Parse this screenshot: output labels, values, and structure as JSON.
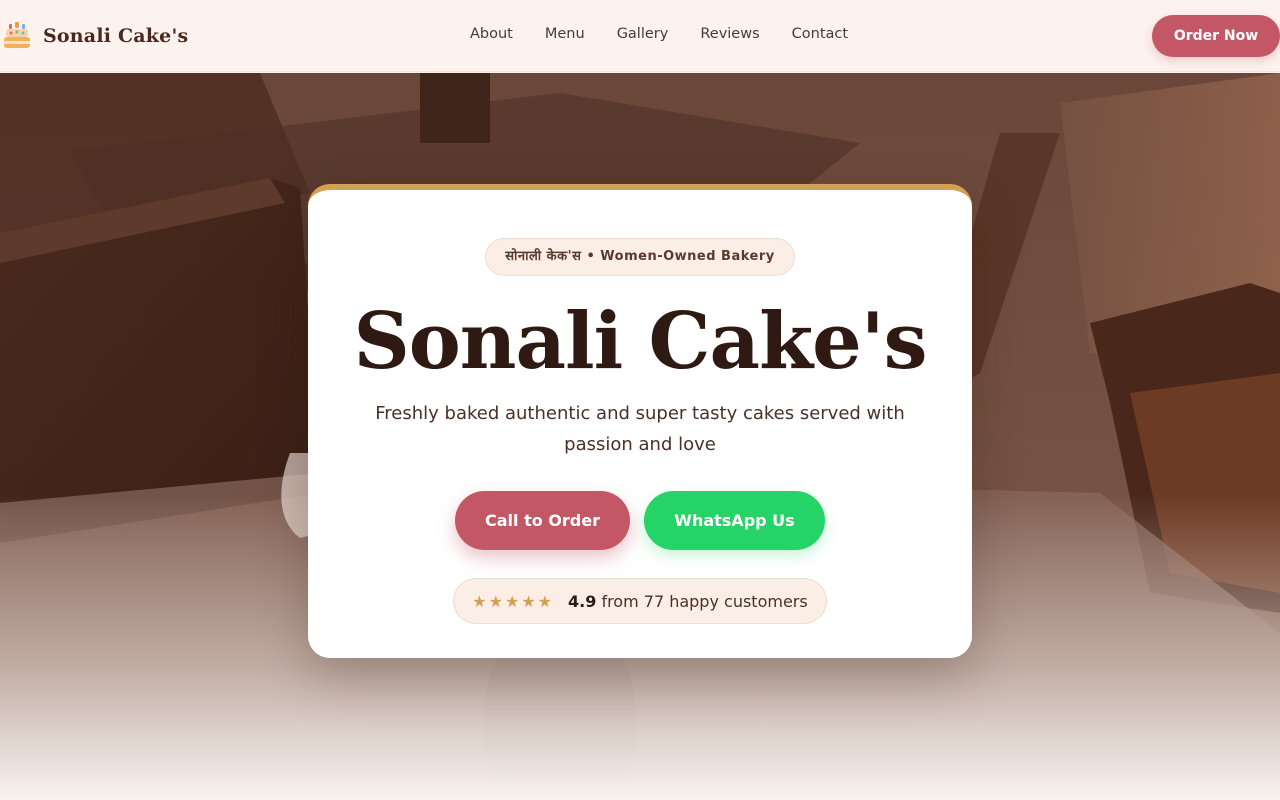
{
  "brand": {
    "name": "Sonali Cake's",
    "logo_icon": "cake-icon"
  },
  "nav": {
    "items": [
      "About",
      "Menu",
      "Gallery",
      "Reviews",
      "Contact"
    ]
  },
  "header": {
    "order_button": "Order Now"
  },
  "hero": {
    "badge": "सोनाली केक'स • Women-Owned Bakery",
    "title": "Sonali Cake's",
    "tagline": "Freshly baked authentic and super tasty cakes served with passion and love",
    "call_button": "Call to Order",
    "whatsapp_button": "WhatsApp Us",
    "rating": {
      "stars": "★★★★★",
      "score": "4.9",
      "text": "from 77 happy customers",
      "value": 5,
      "max": 5
    }
  },
  "colors": {
    "accent": "#c45766",
    "whatsapp": "#25d366",
    "gold": "#d4a055",
    "header_bg": "#fdf3ee",
    "text_dark": "#2e1a12"
  }
}
